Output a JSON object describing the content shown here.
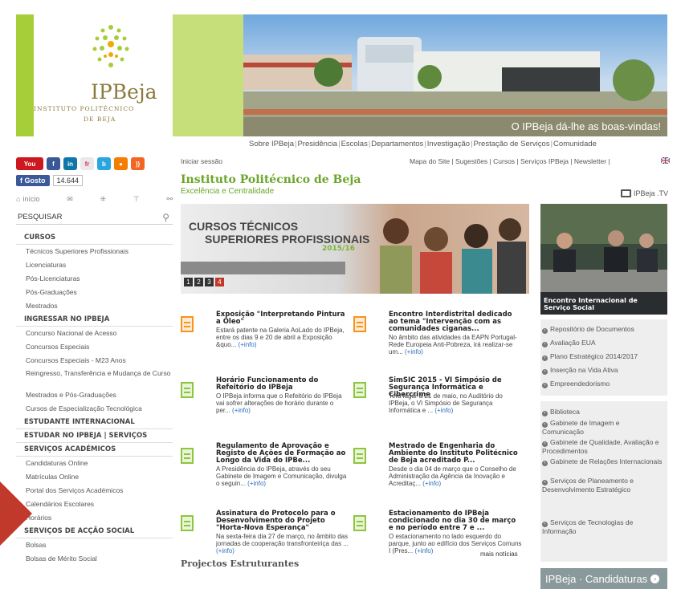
{
  "header": {
    "logo_name": "IPBeja",
    "logo_line1": "INSTITUTO POLITÉCNICO",
    "logo_line2": "DE BEJA",
    "banner_caption": "O IPBeja dá-lhe as boas-vindas!",
    "nav": [
      "Sobre IPBeja",
      "Presidência",
      "Escolas",
      "Departamentos",
      "Investigação",
      "Prestação de Serviços",
      "Comunidade"
    ]
  },
  "social": {
    "buttons": [
      {
        "icon": "youtube-icon",
        "glyph": "You",
        "color": "#cc181e"
      },
      {
        "icon": "facebook-icon",
        "glyph": "f",
        "color": "#3b5998"
      },
      {
        "icon": "linkedin-icon",
        "glyph": "in",
        "color": "#0e76a8"
      },
      {
        "icon": "flickr-icon",
        "glyph": "fr",
        "color": "#e9e9e9"
      },
      {
        "icon": "blogger-icon",
        "glyph": "b",
        "color": "#2aa6de"
      },
      {
        "icon": "circle-icon",
        "glyph": "●",
        "color": "#f57d00"
      },
      {
        "icon": "rss-icon",
        "glyph": "))",
        "color": "#f26522"
      }
    ],
    "like_label": "Gosto",
    "like_count": "14.644"
  },
  "tools": {
    "home_label": "início"
  },
  "search": {
    "placeholder": "PESQUISAR"
  },
  "leftnav": [
    {
      "kind": "head",
      "label": "CURSOS"
    },
    {
      "kind": "item",
      "label": "Técnicos Superiores Profissionais"
    },
    {
      "kind": "item",
      "label": "Licenciaturas"
    },
    {
      "kind": "item",
      "label": "Pós-Licenciaturas"
    },
    {
      "kind": "item",
      "label": "Pós-Graduações"
    },
    {
      "kind": "item",
      "label": "Mestrados"
    },
    {
      "kind": "head",
      "label": "INGRESSAR NO IPBEJA"
    },
    {
      "kind": "item",
      "label": "Concurso Nacional de Acesso"
    },
    {
      "kind": "item",
      "label": "Concursos Especiais"
    },
    {
      "kind": "item",
      "label": "Concursos Especiais - M23 Anos"
    },
    {
      "kind": "item",
      "label": "Reingresso, Transferência e Mudança de Curso"
    },
    {
      "kind": "item",
      "label": "Mestrados e Pós-Graduações"
    },
    {
      "kind": "item",
      "label": "Cursos de Especialização Tecnológica"
    },
    {
      "kind": "head",
      "label": "ESTUDANTE INTERNACIONAL"
    },
    {
      "kind": "head",
      "label": "ESTUDAR NO IPBEJA | SERVIÇOS"
    },
    {
      "kind": "head",
      "label": "SERVIÇOS ACADÉMICOS"
    },
    {
      "kind": "item",
      "label": "Candidaturas Online"
    },
    {
      "kind": "item",
      "label": "Matrículas Online"
    },
    {
      "kind": "item",
      "label": "Portal dos Serviços Académicos"
    },
    {
      "kind": "item",
      "label": "Calendários Escolares"
    },
    {
      "kind": "item",
      "label": "Horários"
    },
    {
      "kind": "head",
      "label": "SERVIÇOS DE ACÇÃO SOCIAL"
    },
    {
      "kind": "item",
      "label": "Bolsas"
    },
    {
      "kind": "item",
      "label": "Bolsas de Mérito Social"
    }
  ],
  "main": {
    "login": "Iniciar sessão",
    "toplinks": "Mapa do Site | Sugestões | Cursos | Serviços IPBeja | Newsletter |",
    "title": "Instituto Politécnico de Beja",
    "subtitle": "Excelência e Centralidade",
    "tv": "IPBeja .TV",
    "slider": {
      "line1": "CURSOS TÉCNICOS",
      "line2": "SUPERIORES PROFISSIONAIS",
      "year": "2015/16",
      "pages": [
        "1",
        "2",
        "3",
        "4"
      ],
      "active_page": "4"
    },
    "news": [
      {
        "title": "Exposição \"Interpretando Pintura a Óleo\"",
        "body": "Estará patente na Galeria AoLado do IPBeja, entre os dias 9 e 20 de abril a Exposição &quo...",
        "more": "(+info)",
        "icon_color": "orange"
      },
      {
        "title": "Encontro Interdistrital dedicado ao tema \"Intervenção com as comunidades ciganas...",
        "body": "No âmbito das atividades da EAPN Portugal-Rede Europeia Anti-Pobreza, irá realizar-se um...",
        "more": "(+info)",
        "icon_color": "orange"
      },
      {
        "title": "Horário Funcionamento do Refeitório do IPBeja",
        "body": "O IPBeja informa que o Refeitório do IPBeja vai sofrer alterações de horário durante o per...",
        "more": "(+info)",
        "icon_color": "green"
      },
      {
        "title": "SimSIC 2015 - VI Simpósio de Segurança Informática e Cibercrime",
        "body": "Terá lugar a 21 de maio, no Auditório do IPBeja, o VI Simpósio de Segurança Informática e ...",
        "more": "(+info)",
        "icon_color": "green"
      },
      {
        "title": "Regulamento de Aprovação e Registo de Ações de Formação ao Longo da Vida do IPBe...",
        "body": "A Presidência do IPBeja, através do seu Gabinete de Imagem e Comunicação, divulga o seguin...",
        "more": "(+info)",
        "icon_color": "green"
      },
      {
        "title": "Mestrado de Engenharia do Ambiente do Instituto Politécnico de Beja acreditado P...",
        "body": "Desde o dia 04 de março que o Conselho de Administração da Agência da Inovação e Acreditaç...",
        "more": "(+info)",
        "icon_color": "green"
      },
      {
        "title": "Assinatura do Protocolo para o Desenvolvimento do Projeto \"Horta-Nova Esperança\"",
        "body": "Na sexta-feira dia 27 de março, no âmbito das jornadas de cooperação transfronteiriça das ...",
        "more": "(+info)",
        "icon_color": "green"
      },
      {
        "title": "Estacionamento do IPBeja condicionado no dia 30 de março e no período entre 7 e ...",
        "body": "O estacionamento no lado esquerdo do parque, junto ao edifício dos Serviços Comuns I (Pres...",
        "more": "(+info)",
        "icon_color": "green"
      }
    ],
    "more_news": "mais notícias",
    "projects_heading": "Projectos Estruturantes"
  },
  "right": {
    "photo_caption": "Encontro Internacional de Serviço Social",
    "links_group1": [
      "Repositório de Documentos",
      "Avaliação EUA",
      "Plano Estratégico 2014/2017",
      "Inserção na Vida Ativa",
      "Empreendedorismo"
    ],
    "links_group2": [
      "Biblioteca",
      "Gabinete de Imagem e Comunicação",
      "Gabinete de Qualidade, Avaliação e Procedimentos",
      "Gabinete de Relações Internacionais",
      "Serviços de Planeamento e Desenvolvimento Estratégico",
      "Serviços de Tecnologias de Informação"
    ],
    "candidaturas": "IPBeja · Candidaturas"
  },
  "colors": {
    "brand_green": "#6ba529",
    "link_blue": "#2a6ebb",
    "icon_green": "#8cc63f",
    "icon_orange": "#f7941d",
    "marker_red": "#c0392b"
  }
}
